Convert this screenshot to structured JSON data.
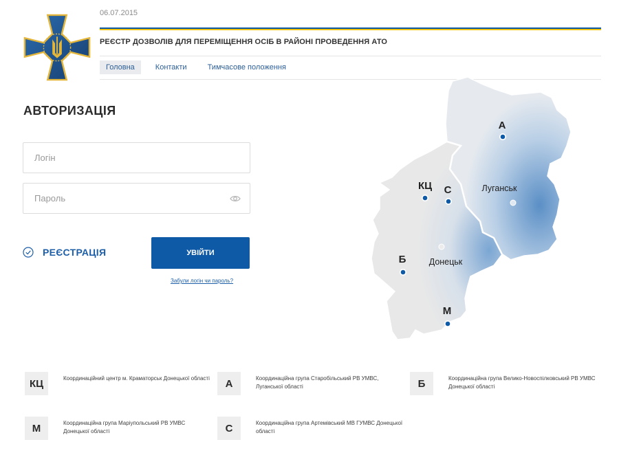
{
  "header": {
    "date": "06.07.2015",
    "title": "РЕЄСТР ДОЗВОЛІВ ДЛЯ ПЕРЕМІЩЕННЯ ОСІБ В РАЙОНІ ПРОВЕДЕННЯ АТО",
    "nav": [
      {
        "label": "Головна",
        "active": true
      },
      {
        "label": "Контакти",
        "active": false
      },
      {
        "label": "Тимчасове положення",
        "active": false
      }
    ]
  },
  "colors": {
    "brand_blue": "#0e5aa7",
    "flag_yellow": "#f5c400",
    "logo_blue": "#1d4e86",
    "logo_gold": "#e3b53a"
  },
  "auth": {
    "title": "АВТОРИЗАЦІЯ",
    "login_placeholder": "Логін",
    "password_placeholder": "Пароль",
    "register_label": "РЕЄСТРАЦІЯ",
    "login_button": "УВІЙТИ",
    "forgot_link": "Забули логін чи пароль?"
  },
  "map": {
    "cities": [
      {
        "name": "Луганськ"
      },
      {
        "name": "Донецьк"
      }
    ],
    "markers": [
      "А",
      "КЦ",
      "С",
      "Б",
      "М"
    ]
  },
  "legend": [
    {
      "code": "КЦ",
      "text": "Координаційний центр м. Краматорськ Донецької області"
    },
    {
      "code": "А",
      "text": "Координаційна група Старобільський РВ УМВС, Луганської області"
    },
    {
      "code": "Б",
      "text": "Координаційна група Велико-Новоспілковський РВ УМВС Донецької області"
    },
    {
      "code": "М",
      "text": "Координаційна група Маріупольський РВ УМВС Донецької області"
    },
    {
      "code": "С",
      "text": "Координаційна група Артемівський МВ ГУМВС Донецької області"
    }
  ]
}
